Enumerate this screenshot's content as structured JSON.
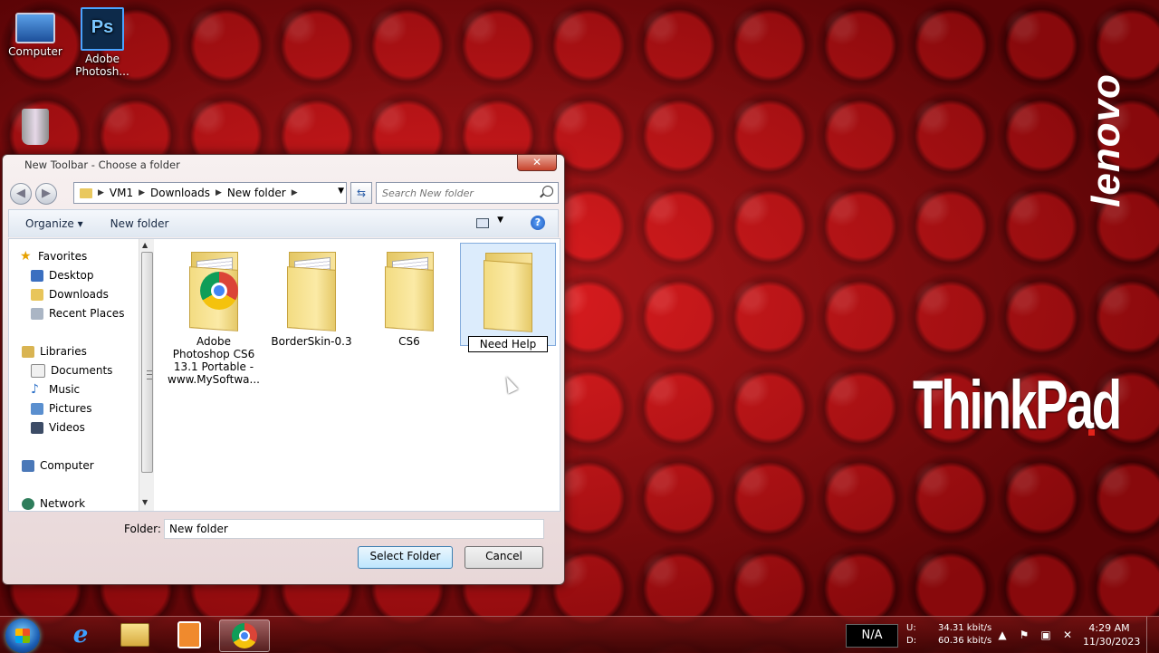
{
  "desktop": {
    "icons": [
      {
        "label": "Computer"
      },
      {
        "label": "Adobe Photosh..."
      },
      {
        "label": ""
      }
    ],
    "brand_vertical": "lenovo",
    "brand_main": "ThinkPad"
  },
  "dialog": {
    "title": "New Toolbar - Choose a folder",
    "close": "✕",
    "breadcrumb": [
      "VM1",
      "Downloads",
      "New folder"
    ],
    "search_placeholder": "Search New folder",
    "toolbar": {
      "organize": "Organize ▾",
      "new_folder": "New folder"
    },
    "nav": {
      "favorites": "Favorites",
      "desktop": "Desktop",
      "downloads": "Downloads",
      "recent": "Recent Places",
      "libraries": "Libraries",
      "documents": "Documents",
      "music": "Music",
      "pictures": "Pictures",
      "videos": "Videos",
      "computer": "Computer",
      "network": "Network"
    },
    "files": [
      {
        "name": "Adobe Photoshop CS6 13.1 Portable - www.MySoftwa...",
        "icon": "chrome-shortcut-folder"
      },
      {
        "name": "BorderSkin-0.3",
        "icon": "folder"
      },
      {
        "name": "CS6",
        "icon": "folder"
      },
      {
        "name": "Need Help",
        "icon": "folder",
        "selected": true,
        "renaming": true
      }
    ],
    "folder_label": "Folder:",
    "folder_value": "New folder",
    "select_button": "Select Folder",
    "cancel_button": "Cancel"
  },
  "taskbar": {
    "na": "N/A",
    "upload_label": "U:",
    "download_label": "D:",
    "upload_speed": "34.31 kbit/s",
    "download_speed": "60.36 kbit/s",
    "time": "4:29 AM",
    "date": "11/30/2023"
  }
}
